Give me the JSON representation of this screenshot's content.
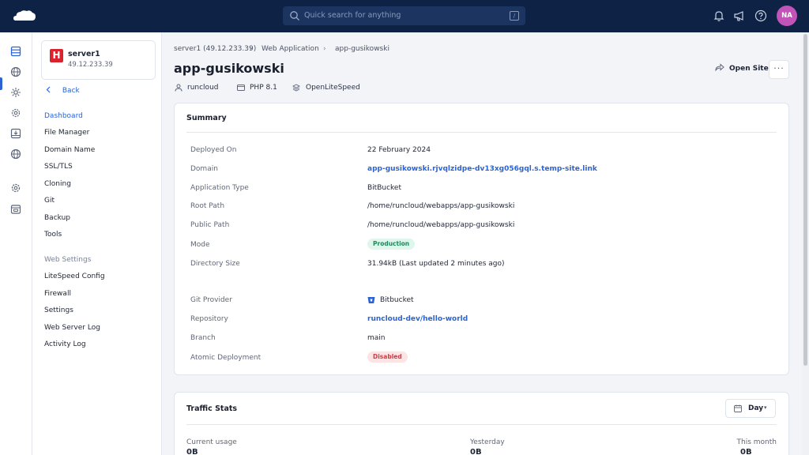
{
  "topbar": {
    "search_placeholder": "Quick search for anything",
    "search_shortcut": "/",
    "avatar_initials": "NA"
  },
  "server": {
    "logo_letter": "H",
    "name": "server1",
    "ip": "49.12.233.39"
  },
  "subnav": {
    "back_label": "Back",
    "items": [
      "Dashboard",
      "File Manager",
      "Domain Name",
      "SSL/TLS",
      "Cloning",
      "Git",
      "Backup",
      "Tools"
    ],
    "section_label": "Web Settings",
    "settings_items": [
      "LiteSpeed Config",
      "Firewall",
      "Settings",
      "Web Server Log",
      "Activity Log"
    ]
  },
  "breadcrumb": [
    "server1 (49.12.233.39)",
    "Web Application",
    "app-gusikowski"
  ],
  "page": {
    "title": "app-gusikowski",
    "open_site_label": "Open Site",
    "more_label": "···",
    "meta": {
      "user": "runcloud",
      "php": "PHP 8.1",
      "server": "OpenLiteSpeed"
    }
  },
  "summary": {
    "title": "Summary",
    "rows": [
      {
        "label": "Deployed On",
        "value": "22 February 2024"
      },
      {
        "label": "Domain",
        "value": "app-gusikowski.rjvqlzidpe-dv13xg056gql.s.temp-site.link"
      },
      {
        "label": "Application Type",
        "value": "BitBucket"
      },
      {
        "label": "Root Path",
        "value": "/home/runcloud/webapps/app-gusikowski"
      },
      {
        "label": "Public Path",
        "value": "/home/runcloud/webapps/app-gusikowski"
      },
      {
        "label": "Mode",
        "value": "Production"
      },
      {
        "label": "Directory Size",
        "value": "31.94kB (Last updated 2 minutes ago)"
      }
    ],
    "git_rows": [
      {
        "label": "Git Provider",
        "value": "Bitbucket"
      },
      {
        "label": "Repository",
        "value": "runcloud-dev/hello-world"
      },
      {
        "label": "Branch",
        "value": "main"
      },
      {
        "label": "Atomic Deployment",
        "value": "Disabled"
      }
    ]
  },
  "traffic": {
    "title": "Traffic Stats",
    "period": "Day",
    "stats": [
      {
        "label": "Current usage",
        "value": "0B"
      },
      {
        "label": "Yesterday",
        "value": "0B"
      },
      {
        "label": "This month",
        "value": "0B"
      }
    ]
  },
  "colors": {
    "topbar": "#0e2245",
    "accent": "#2b63d4",
    "success": "#1b8a5a",
    "danger": "#d33a45"
  }
}
